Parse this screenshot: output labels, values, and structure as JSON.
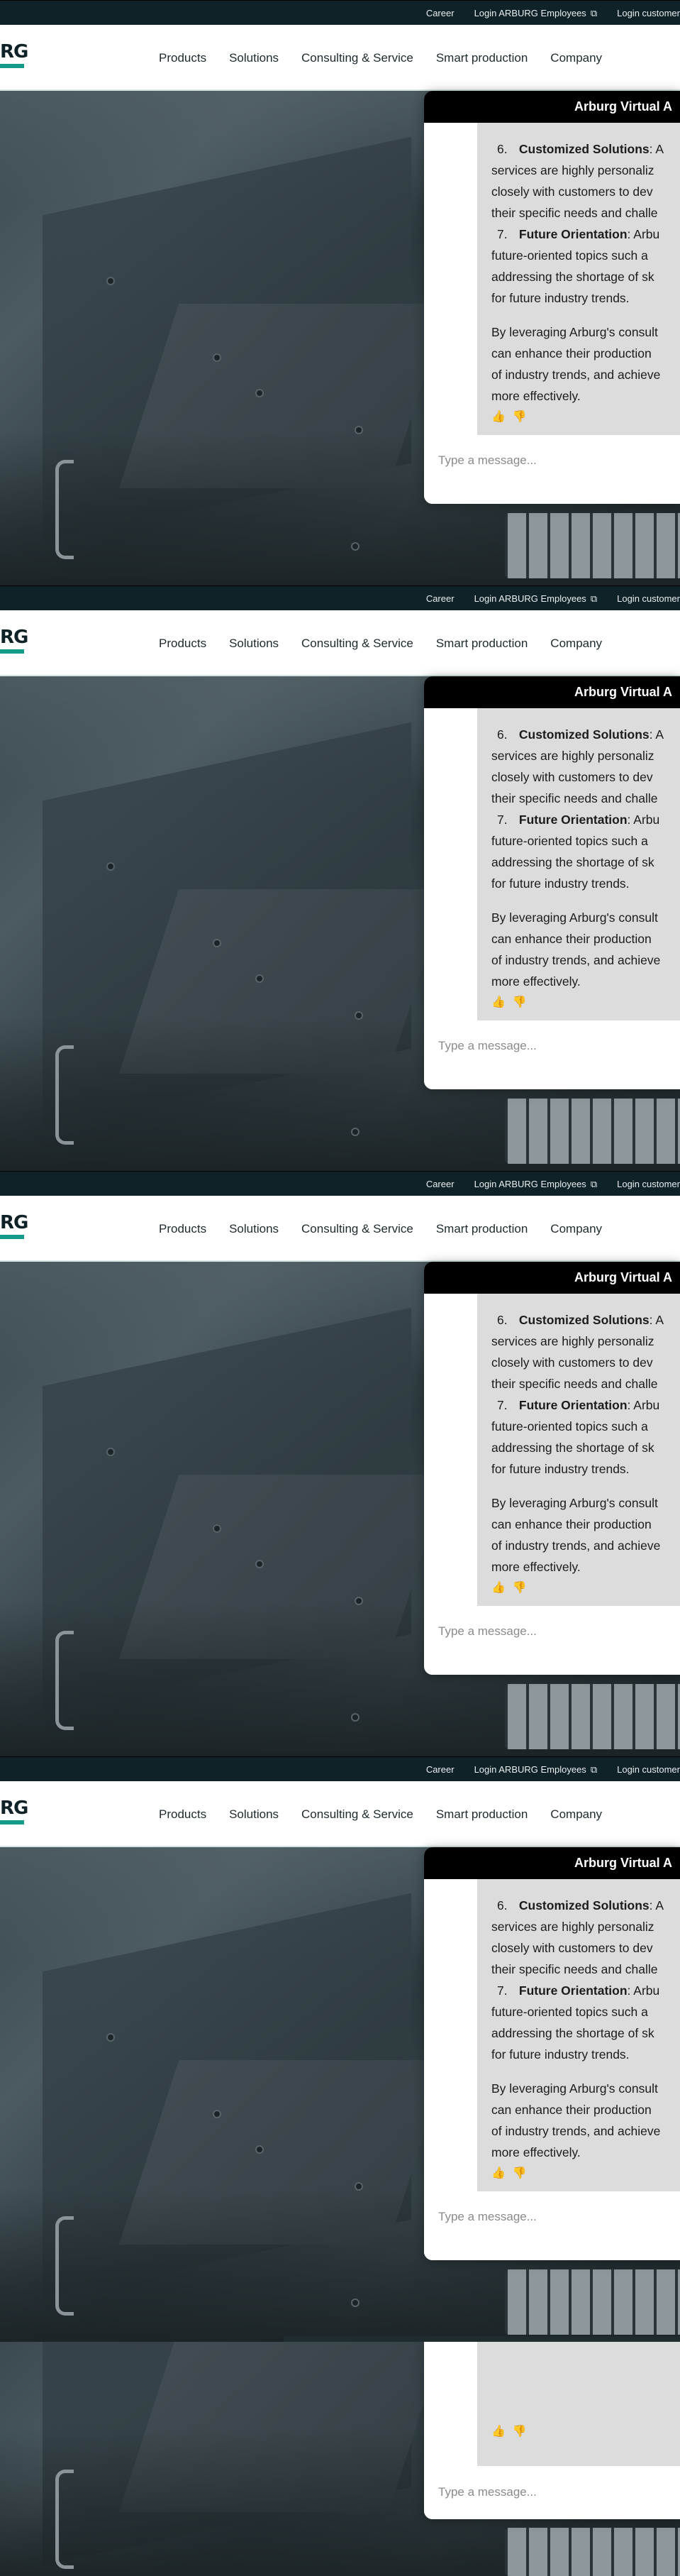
{
  "topbar": {
    "links": [
      "Career",
      "Login ARBURG Employees",
      "Login customer"
    ]
  },
  "logo": {
    "text": "RG"
  },
  "nav": {
    "items": [
      "Products",
      "Solutions",
      "Consulting & Service",
      "Smart production",
      "Company"
    ]
  },
  "chat": {
    "title": "Arburg Virtual A",
    "items": [
      {
        "num": "6.",
        "heading": "Customized Solutions",
        "text": ": A",
        "lines": [
          "services are highly personaliz",
          "closely with customers to dev",
          "their specific needs and challe"
        ]
      },
      {
        "num": "7.",
        "heading": "Future Orientation",
        "text": ": Arbu",
        "lines": [
          "future-oriented topics such a",
          "addressing the shortage of sk",
          "for future industry trends."
        ]
      }
    ],
    "paragraph": [
      "By leveraging Arburg's consult",
      "can enhance their production",
      "of industry trends, and achieve",
      "more effectively."
    ],
    "feedback": {
      "up": "👍",
      "down": "👎"
    },
    "input_placeholder": "Type a message..."
  }
}
